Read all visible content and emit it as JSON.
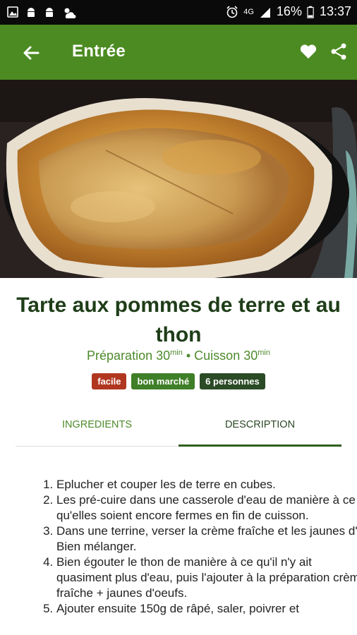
{
  "status_bar": {
    "network": "4G",
    "battery": "16%",
    "time": "13:37"
  },
  "app_bar": {
    "title": "Entrée"
  },
  "recipe": {
    "title": "Tarte aux pommes de terre et au thon",
    "prep_label": "Préparation 30",
    "cook_label": "Cuisson 30",
    "time_unit": "min",
    "separator": " • ",
    "badges": [
      {
        "label": "facile",
        "color": "#b0361f"
      },
      {
        "label": "bon marché",
        "color": "#3f7f27"
      },
      {
        "label": "6 personnes",
        "color": "#2b4a26"
      }
    ]
  },
  "tabs": [
    {
      "label": "INGREDIENTS",
      "active": false
    },
    {
      "label": "DESCRIPTION",
      "active": true
    }
  ],
  "steps": [
    "Eplucher et couper les de terre en cubes.",
    "Les pré-cuire dans une casserole d'eau de manière à ce qu'elles soient encore fermes en fin de cuisson.",
    "Dans une terrine, verser la crème fraîche et les jaunes d'. Bien mélanger.",
    "Bien égouter le thon de manière à ce qu'il n'y ait quasiment plus d'eau, puis l'ajouter à la préparation crème fraîche + jaunes d'oeufs.",
    "Ajouter ensuite 150g de râpé, saler, poivrer et"
  ],
  "colors": {
    "accent": "#4c8b22",
    "title": "#1e3d18",
    "subtitle": "#4e8a2c"
  }
}
